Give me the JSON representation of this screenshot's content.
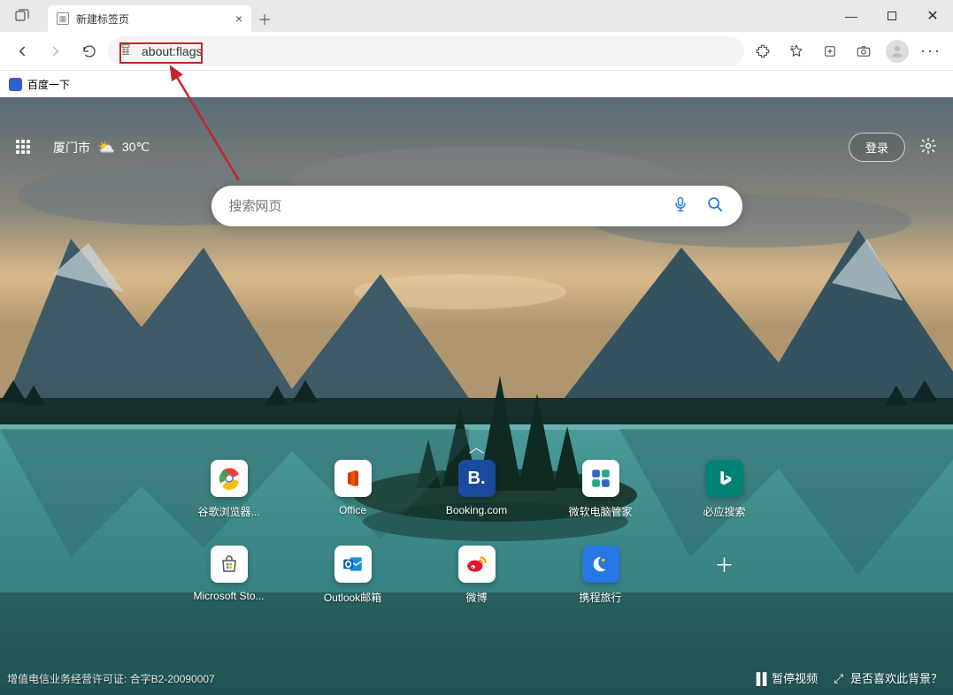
{
  "tab": {
    "title": "新建标签页"
  },
  "addressbar": {
    "value": "about:flags"
  },
  "bookmarks": {
    "item1": "百度一下"
  },
  "weather": {
    "city": "厦门市",
    "temp": "30℃"
  },
  "header": {
    "signin": "登录"
  },
  "search": {
    "placeholder": "搜索网页"
  },
  "tiles": {
    "r1": [
      {
        "label": "谷歌浏览器...",
        "icon": "chrome"
      },
      {
        "label": "Office",
        "icon": "office"
      },
      {
        "label": "Booking.com",
        "icon": "booking"
      },
      {
        "label": "微软电脑管家",
        "icon": "pcmanager"
      },
      {
        "label": "必应搜索",
        "icon": "bing"
      }
    ],
    "r2": [
      {
        "label": "Microsoft Sto...",
        "icon": "msstore"
      },
      {
        "label": "Outlook邮箱",
        "icon": "outlook"
      },
      {
        "label": "微博",
        "icon": "weibo"
      },
      {
        "label": "携程旅行",
        "icon": "ctrip"
      }
    ]
  },
  "footer": {
    "license": "增值电信业务经营许可证: 合字B2-20090007",
    "pause": "暂停视频",
    "like_bg": "是否喜欢此背景？"
  }
}
